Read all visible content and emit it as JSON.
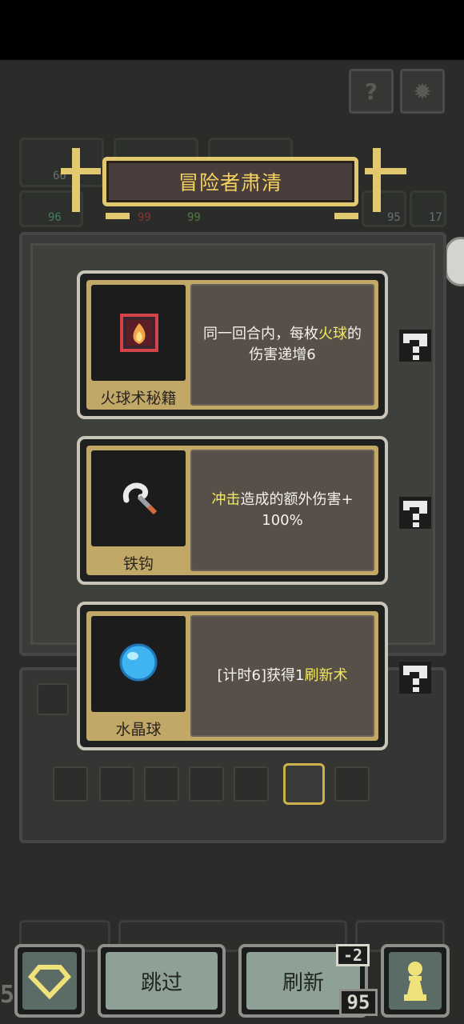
{
  "banner": {
    "title": "冒险者肃清"
  },
  "background_stats": [
    "66",
    "96",
    "99",
    "99",
    "95",
    "17"
  ],
  "cards": [
    {
      "name": "火球术秘籍",
      "icon": "fire-book-icon",
      "desc_parts": [
        "同一回合内，每枚",
        "火球",
        "的伤害递增6"
      ]
    },
    {
      "name": "铁钩",
      "icon": "iron-hook-icon",
      "desc_parts": [
        "冲击",
        "造成的额外伤害+",
        "100%"
      ]
    },
    {
      "name": "水晶球",
      "icon": "crystal-ball-icon",
      "desc_parts": [
        "[计时6]获得1",
        "刷新术"
      ]
    }
  ],
  "bottom": {
    "skip_label": "跳过",
    "refresh_label": "刷新",
    "refresh_cost": "-2",
    "gold": "95",
    "left_edge_number": "5"
  },
  "colors": {
    "accent_gold": "#e2c96f",
    "highlight": "#f2e95a",
    "button": "#8ea197"
  }
}
